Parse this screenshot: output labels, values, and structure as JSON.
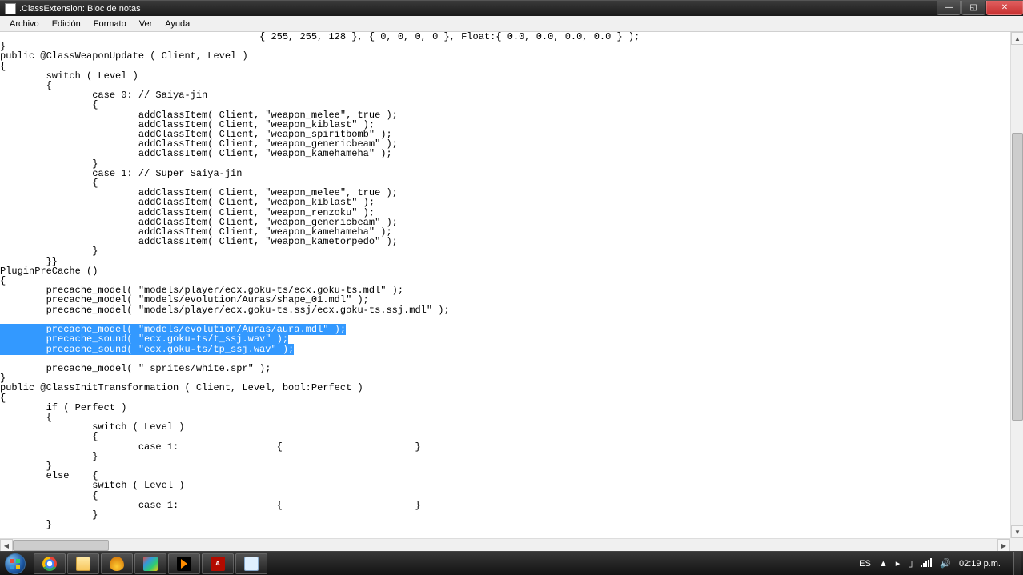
{
  "window": {
    "title": ".ClassExtension: Bloc de notas"
  },
  "menu": {
    "archivo": "Archivo",
    "edicion": "Edición",
    "formato": "Formato",
    "ver": "Ver",
    "ayuda": "Ayuda"
  },
  "code": {
    "pre": "                                             { 255, 255, 128 }, { 0, 0, 0, 0 }, Float:{ 0.0, 0.0, 0.0, 0.0 } );\n}\npublic @ClassWeaponUpdate ( Client, Level )\n{\n        switch ( Level )\n        {\n                case 0: // Saiya-jin\n                {\n                        addClassItem( Client, \"weapon_melee\", true );\n                        addClassItem( Client, \"weapon_kiblast\" );\n                        addClassItem( Client, \"weapon_spiritbomb\" );\n                        addClassItem( Client, \"weapon_genericbeam\" );\n                        addClassItem( Client, \"weapon_kamehameha\" );\n                }\n                case 1: // Super Saiya-jin\n                {\n                        addClassItem( Client, \"weapon_melee\", true );\n                        addClassItem( Client, \"weapon_kiblast\" );\n                        addClassItem( Client, \"weapon_renzoku\" );\n                        addClassItem( Client, \"weapon_genericbeam\" );\n                        addClassItem( Client, \"weapon_kamehameha\" );\n                        addClassItem( Client, \"weapon_kametorpedo\" );\n                }\n        }}\nPluginPreCache ()\n{\n        precache_model( \"models/player/ecx.goku-ts/ecx.goku-ts.mdl\" );\n        precache_model( \"models/evolution/Auras/shape_01.mdl\" );\n        precache_model( \"models/player/ecx.goku-ts.ssj/ecx.goku-ts.ssj.mdl\" );\n\n",
    "sel1": "        precache_model( \"models/evolution/Auras/aura.mdl\" );",
    "sel2": "        precache_sound( \"ecx.goku-ts/t_ssj.wav\" );",
    "sel3": "        precache_sound( \"ecx.goku-ts/tp_ssj.wav\" );",
    "post": "\n\n        precache_model( \" sprites/white.spr\" );\n}\npublic @ClassInitTransformation ( Client, Level, bool:Perfect )\n{\n        if ( Perfect )\n        {\n                switch ( Level )\n                {\n                        case 1:                 {                       }\n                }\n        }\n        else    {\n                switch ( Level )\n                {\n                        case 1:                 {                       }\n                }\n        }"
  },
  "taskbar": {
    "pdf_label": "A",
    "lang": "ES",
    "chevron": "▲",
    "time": "02:19 p.m."
  }
}
